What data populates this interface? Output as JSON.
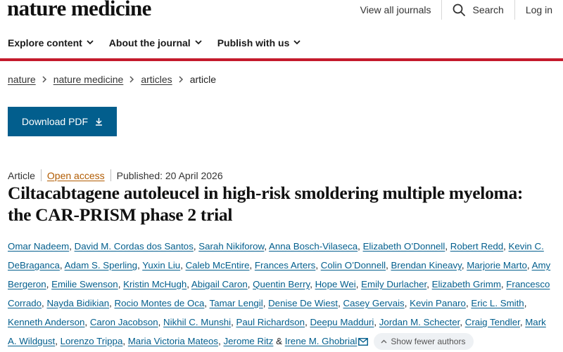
{
  "brand": {
    "logo": "nature medicine"
  },
  "top_links": {
    "journals": "View all journals",
    "search": "Search",
    "login": "Log in"
  },
  "nav": [
    {
      "label": "Explore content"
    },
    {
      "label": "About the journal"
    },
    {
      "label": "Publish with us"
    }
  ],
  "breadcrumb": [
    {
      "label": "nature"
    },
    {
      "label": "nature medicine"
    },
    {
      "label": "articles"
    },
    {
      "label": "article"
    }
  ],
  "download_label": "Download PDF",
  "meta": {
    "type": "Article",
    "access": "Open access",
    "published": "Published: 20 April 2026"
  },
  "title": "Ciltacabtagene autoleucel in high-risk smoldering multiple myeloma: the CAR-PRISM phase 2 trial",
  "authors": [
    "Omar Nadeem",
    "David M. Cordas dos Santos",
    "Sarah Nikiforow",
    "Anna Bosch-Vilaseca",
    "Elizabeth O’Donnell",
    "Robert Redd",
    "Kevin C. DeBraganca",
    "Adam S. Sperling",
    "Yuxin Liu",
    "Caleb McEntire",
    "Frances Arters",
    "Colin O’Donnell",
    "Brendan Kineavy",
    "Marjorie Marto",
    "Amy Bergeron",
    "Emilie Swenson",
    "Kristin McHugh",
    "Abigail Caron",
    "Quentin Berry",
    "Hope Wei",
    "Emily Durlacher",
    "Elizabeth Grimm",
    "Francesco Corrado",
    "Nayda Bidikian",
    "Rocio Montes de Oca",
    "Tamar Lengil",
    "Denise De Wiest",
    "Casey Gervais",
    "Kevin Panaro",
    "Eric L. Smith",
    "Kenneth Anderson",
    "Caron Jacobson",
    "Nikhil C. Munshi",
    "Paul Richardson",
    "Deepu Madduri",
    "Jordan M. Schecter",
    "Craig Tendler",
    "Mark A. Wildgust",
    "Lorenzo Trippa",
    "Maria Victoria Mateos",
    "Jerome Ritz",
    "Irene M. Ghobrial"
  ],
  "authors_conjunction": "&",
  "show_fewer_label": "Show fewer authors",
  "colors": {
    "primary": "#025e8d",
    "accent_red": "#c41a2c",
    "open_access": "#b15b00"
  },
  "icons": {
    "search": "search-icon",
    "chevron": "chevron-down-icon",
    "download": "download-icon",
    "mail": "mail-icon",
    "collapse": "chevron-up-icon"
  }
}
